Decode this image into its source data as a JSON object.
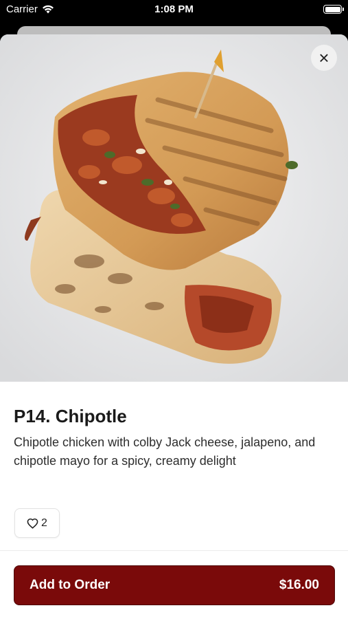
{
  "status_bar": {
    "carrier": "Carrier",
    "time": "1:08 PM"
  },
  "item": {
    "title": "P14. Chipotle",
    "description": "Chipotle chicken with colby Jack cheese, jalapeno, and chipotle mayo for a spicy, creamy delight",
    "likes": "2"
  },
  "actions": {
    "close_icon": "close-icon",
    "add_label": "Add to Order",
    "price": "$16.00"
  },
  "colors": {
    "accent": "#7a0a0a",
    "background": "#ffffff"
  }
}
